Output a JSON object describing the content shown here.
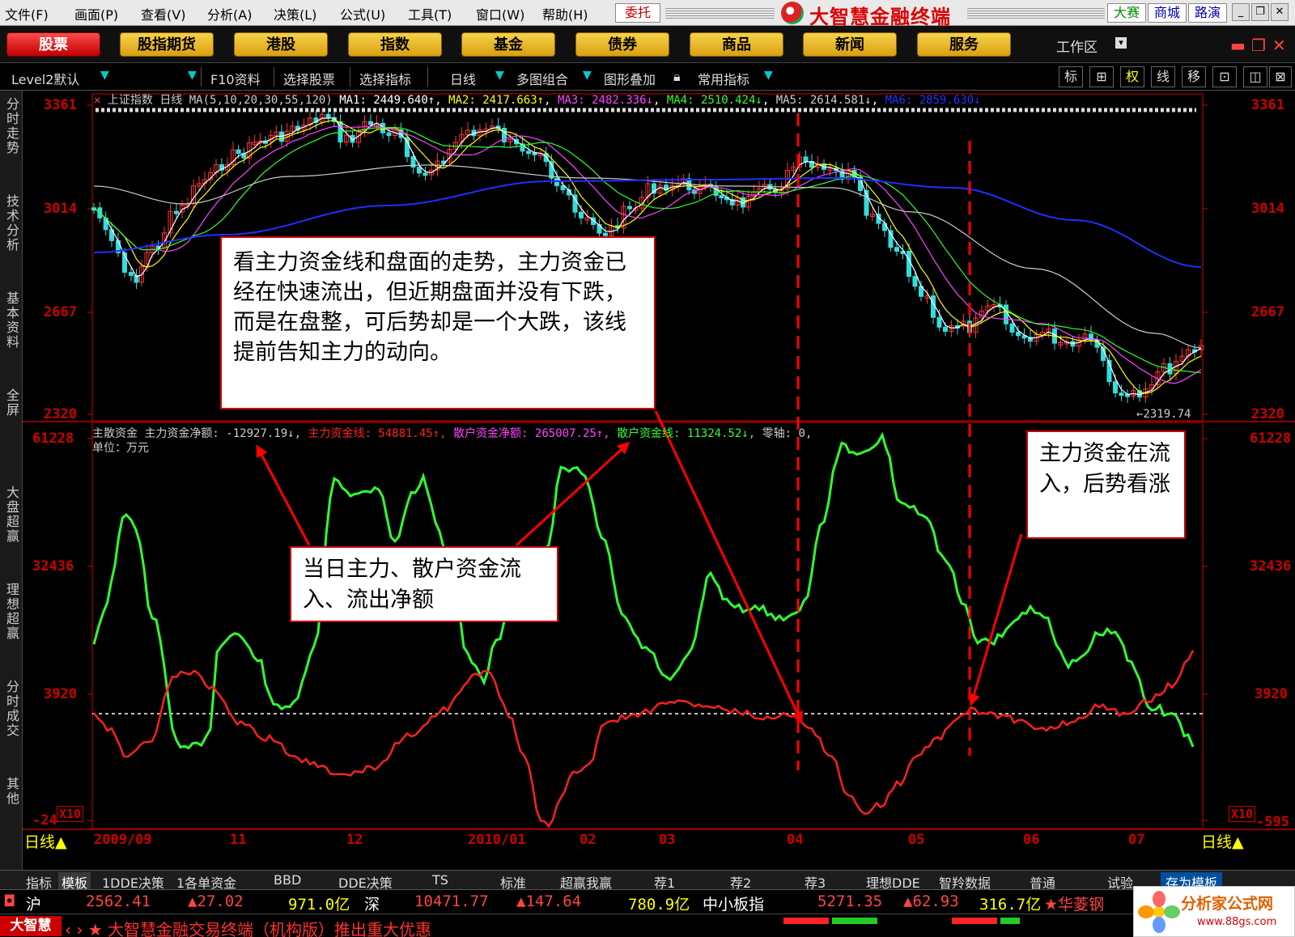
{
  "menubar": {
    "items": [
      "文件(F)",
      "画面(P)",
      "查看(V)",
      "分析(A)",
      "决策(L)",
      "公式(U)",
      "工具(T)",
      "窗口(W)",
      "帮助(H)"
    ],
    "weituo": "委托",
    "app_title": "大智慧金融终端",
    "links": [
      "大赛",
      "商城",
      "路演"
    ],
    "window_buttons": [
      "_",
      "❐",
      "✕"
    ]
  },
  "category_tabs": [
    "股票",
    "股指期货",
    "港股",
    "指数",
    "基金",
    "债券",
    "商品",
    "新闻",
    "服务"
  ],
  "workspace_label": "工作区",
  "toolbar": {
    "items": [
      "Level2默认",
      "F10资料",
      "选择股票",
      "选择指标",
      "日线",
      "多图组合",
      "图形叠加",
      "常用指标"
    ],
    "right": [
      "标",
      "⊞",
      "权",
      "线",
      "移",
      "⊡",
      "◫",
      "⊠"
    ]
  },
  "sidebar_tabs": [
    "分时走势",
    "技术分析",
    "基本资料",
    "全屏",
    "大盘超赢",
    "理想超赢",
    "分时成交",
    "其他"
  ],
  "price_panel": {
    "index_name": "上证指数",
    "period": "日线",
    "ma_legend": {
      "prefix": "MA(5,10,20,30,55,120)",
      "ma1": "MA1: 2449.640↑",
      "ma2": "MA2: 2417.663↑",
      "ma3": "MA3: 2482.336↓",
      "ma4": "MA4: 2510.424↓",
      "ma5": "MA5: 2614.581↓",
      "ma6": "MA6: 2859.630↓"
    },
    "y_labels": [
      "3361",
      "3014",
      "2667",
      "2320"
    ],
    "low_label": "←2319.74"
  },
  "flow_panel": {
    "title": "主散资金",
    "net_main": "主力资金净额: -12927.19↓,",
    "main_line": "主力资金线: 54881.45↑,",
    "retail_net": "散户资金净额: 265007.25↑,",
    "retail_line": "散户资金线: 11324.52↓,",
    "zero_axis": "零轴: 0,",
    "unit": "单位：万元",
    "y_labels": [
      "61228",
      "32436",
      "3920",
      "-24"
    ],
    "right_bottom_label": "-595",
    "x10": "X10"
  },
  "x_axis": {
    "period": "日线",
    "labels": [
      "2009/09",
      "11",
      "12",
      "2010/01",
      "02",
      "03",
      "04",
      "05",
      "06",
      "07"
    ]
  },
  "annotations": {
    "top_box": "看主力资金线和盘面的走势，主力资金已经在快速流出，但近期盘面并没有下跌，而是在盘整，可后势却是一个大跌，该线提前告知主力的动向。",
    "middle_box": "当日主力、散户资金流入、流出净额",
    "right_box": "主力资金在流入，后势看涨"
  },
  "sub_tabs": [
    "指标",
    "模板",
    "1DDE决策",
    "1各单资金",
    "BBD",
    "DDE决策",
    "TS",
    "标准",
    "超赢我赢",
    "荐1",
    "荐2",
    "荐3",
    "理想DDE",
    "智羚数据",
    "普通",
    "试验",
    "存为模板"
  ],
  "ticker": {
    "sh_label": "沪",
    "sh_value": "2562.41",
    "sh_change": "▲27.02",
    "sh_amount": "971.0亿",
    "sz_label": "深",
    "sz_value": "10471.77",
    "sz_change": "▲147.64",
    "sz_amount": "780.9亿",
    "sme_label": "中小板指",
    "sme_value": "5271.35",
    "sme_change": "▲62.93",
    "sme_amount": "316.7亿",
    "stock": "★华菱钢"
  },
  "status": {
    "brand": "大智慧",
    "promo": "大智慧金融交易终端（机构版）推出重大优惠"
  },
  "watermark": {
    "title": "分析家公式网",
    "url": "www.88gs.com"
  },
  "colors": {
    "main_line": "#ff2020",
    "retail_line": "#30ff30",
    "ma1": "#ffffff",
    "ma2": "#ffff00",
    "ma3": "#ff40ff",
    "ma4": "#30ff30",
    "ma5": "#cccccc",
    "ma6": "#2030ff"
  }
}
